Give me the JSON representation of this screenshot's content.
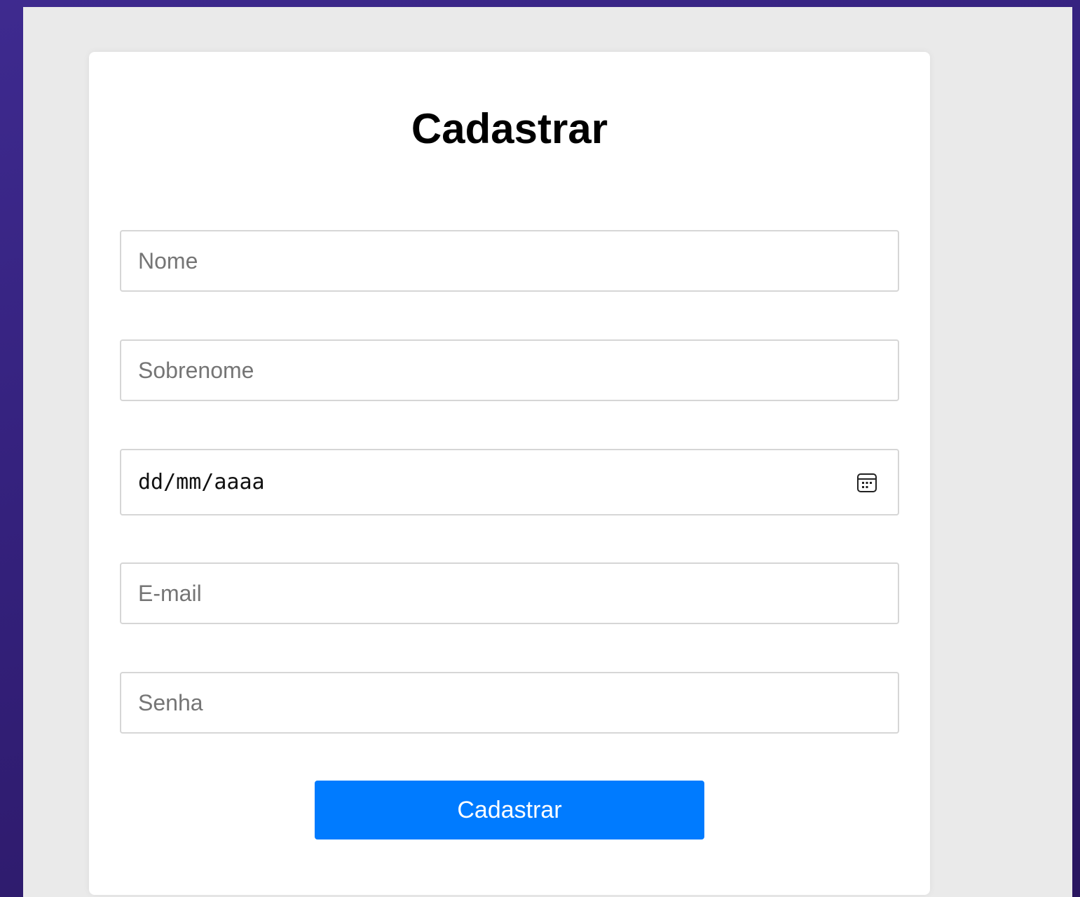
{
  "page": {
    "background_color": "#34207a",
    "viewport_background": "#eaeaea"
  },
  "form": {
    "title": "Cadastrar",
    "fields": {
      "nome": {
        "placeholder": "Nome",
        "value": ""
      },
      "sobrenome": {
        "placeholder": "Sobrenome",
        "value": ""
      },
      "data_nascimento": {
        "display": "dd/mm/aaaa",
        "icon": "calendar-icon"
      },
      "email": {
        "placeholder": "E-mail",
        "value": ""
      },
      "senha": {
        "placeholder": "Senha",
        "value": ""
      }
    },
    "submit_label": "Cadastrar",
    "accent_color": "#007bff"
  }
}
